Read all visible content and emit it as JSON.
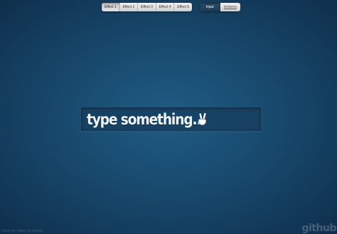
{
  "effects": {
    "items": [
      "Effect 1",
      "Effect 2",
      "Effect 3",
      "Effect 4",
      "Effect 5"
    ],
    "selected_index": 0
  },
  "mode_toggle": {
    "input_label": "input",
    "textarea_label": "textarea",
    "selected": "input"
  },
  "field": {
    "placeholder": "type something..."
  },
  "icons": {
    "hand": "victory-hand-icon"
  },
  "branding": {
    "logo_text": "github",
    "footer_text": "Demo by Hakim El Hattab"
  },
  "colors": {
    "background_center": "#1f5c84",
    "background_edge": "#0f2f4c",
    "field_background": "#173c5c",
    "text": "#eef4f8"
  }
}
